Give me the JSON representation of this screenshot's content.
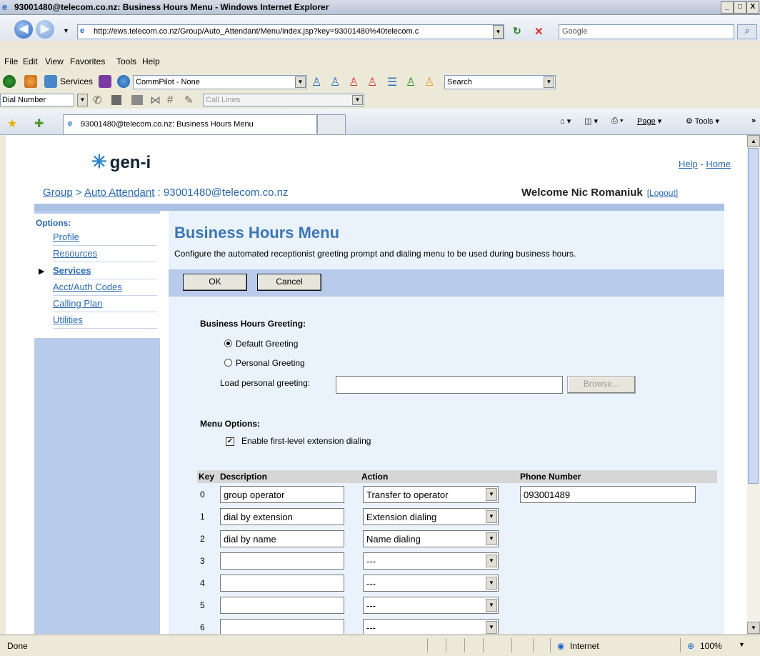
{
  "window": {
    "title": "93001480@telecom.co.nz: Business Hours Menu - Windows Internet Explorer",
    "minimize": "_",
    "maximize": "□",
    "close": "X"
  },
  "address": {
    "url": "http://ews.telecom.co.nz/Group/Auto_Attendant/Menu/index.jsp?key=93001480%40telecom.c",
    "search_placeholder": "Google"
  },
  "menu": [
    "File",
    "Edit",
    "View",
    "Favorites",
    "Tools",
    "Help"
  ],
  "toolbar1": {
    "services_label": "Services",
    "commpilot_value": "CommPilot - None",
    "search_value": "Search"
  },
  "toolbar2": {
    "dial_label": "Dial Number",
    "call_lines": "Call Lines"
  },
  "tab": {
    "title": "93001480@telecom.co.nz: Business Hours Menu"
  },
  "commands": {
    "page": "Page",
    "tools": "Tools"
  },
  "header": {
    "logo": "gen-i",
    "help": "Help",
    "dash": "-",
    "home": "Home",
    "breadcrumb_group": "Group",
    "breadcrumb_sep": ">",
    "breadcrumb_aa": "Auto Attendant",
    "breadcrumb_colon": ":",
    "breadcrumb_user": "93001480@telecom.co.nz",
    "welcome": "Welcome Nic Romaniuk",
    "logout": "[Logout]"
  },
  "sidebar": {
    "heading": "Options:",
    "items": [
      {
        "label": "Profile"
      },
      {
        "label": "Resources"
      },
      {
        "label": "Services",
        "selected": true
      },
      {
        "label": "Acct/Auth Codes"
      },
      {
        "label": "Calling Plan"
      },
      {
        "label": "Utilities"
      }
    ]
  },
  "main": {
    "title": "Business Hours Menu",
    "description": "Configure the automated receptionist greeting prompt and dialing menu to be used during business hours.",
    "ok": "OK",
    "cancel": "Cancel",
    "greeting_heading": "Business Hours Greeting:",
    "default_greeting": "Default Greeting",
    "personal_greeting": "Personal Greeting",
    "load_label": "Load personal greeting:",
    "browse": "Browse...",
    "menu_options": "Menu Options:",
    "enable_ext": "Enable first-level extension dialing",
    "enable_ext_checked": true
  },
  "table": {
    "headers": [
      "Key",
      "Description",
      "Action",
      "Phone Number"
    ],
    "rows": [
      {
        "key": "0",
        "description": "group operator",
        "action": "Transfer to operator",
        "phone": "093001489"
      },
      {
        "key": "1",
        "description": "dial by extension",
        "action": "Extension dialing",
        "phone": ""
      },
      {
        "key": "2",
        "description": "dial by name",
        "action": "Name dialing",
        "phone": ""
      },
      {
        "key": "3",
        "description": "",
        "action": "---",
        "phone": ""
      },
      {
        "key": "4",
        "description": "",
        "action": "---",
        "phone": ""
      },
      {
        "key": "5",
        "description": "",
        "action": "---",
        "phone": ""
      },
      {
        "key": "6",
        "description": "",
        "action": "---",
        "phone": ""
      }
    ]
  },
  "status": {
    "left": "Done",
    "zone": "Internet",
    "zoom": "100%"
  }
}
